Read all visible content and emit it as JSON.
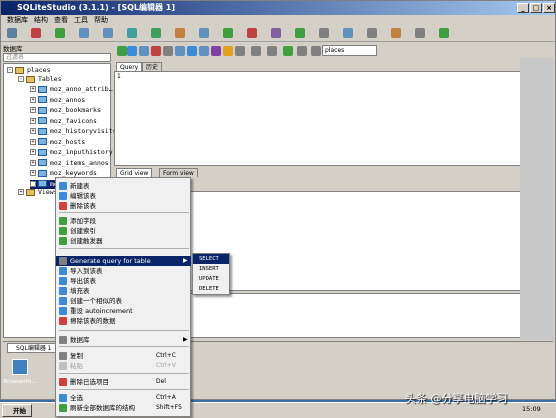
{
  "title": "SQLiteStudio (3.1.1) - [SQL编辑器 1]",
  "menu": [
    "数据库",
    "结构",
    "查看",
    "工具",
    "帮助"
  ],
  "sidebar": {
    "title": "数据库",
    "filter_placeholder": "过滤名",
    "db": "places",
    "db_version": "(SQLite 3)",
    "tables_label": "Tables",
    "tables_count": "(10)",
    "tables": [
      "moz_anno_attrib…",
      "moz_annos",
      "moz_bookmarks",
      "moz_favicons",
      "moz_historyvisits",
      "moz_hosts",
      "moz_inputhistory",
      "moz_items_annos",
      "moz_keywords",
      "moz_places"
    ],
    "views": "Views"
  },
  "editor": {
    "db_select": "places",
    "tabs": [
      "Query",
      "历史"
    ],
    "result_tabs": [
      "Grid view",
      "Form view"
    ]
  },
  "bottom_tab": "SQL编辑器 1",
  "context_menu": [
    {
      "label": "新建表",
      "shortcut": "",
      "icon": "new-table-icon",
      "color": "#3c8ad8"
    },
    {
      "label": "编辑该表",
      "shortcut": "",
      "icon": "edit-table-icon",
      "color": "#3c8ad8"
    },
    {
      "label": "删除该表",
      "shortcut": "",
      "icon": "delete-table-icon",
      "color": "#d04040"
    },
    {
      "label": "添加字段",
      "shortcut": "",
      "icon": "add-column-icon",
      "color": "#40a040"
    },
    {
      "label": "创建索引",
      "shortcut": "",
      "icon": "index-icon",
      "color": "#40a040"
    },
    {
      "label": "创建触发器",
      "shortcut": "",
      "icon": "trigger-icon",
      "color": "#40a040"
    },
    {
      "label": "Generate query for table",
      "shortcut": "",
      "icon": "generate-icon",
      "color": "#808080"
    },
    {
      "label": "导入到该表",
      "shortcut": "",
      "icon": "import-icon",
      "color": "#3c8ad8"
    },
    {
      "label": "导出该表",
      "shortcut": "",
      "icon": "export-icon",
      "color": "#3c8ad8"
    },
    {
      "label": "填充表",
      "shortcut": "",
      "icon": "populate-icon",
      "color": "#3c8ad8"
    },
    {
      "label": "创建一个相似的表",
      "shortcut": "",
      "icon": "similar-table-icon",
      "color": "#3c8ad8"
    },
    {
      "label": "重设 autoincrement",
      "shortcut": "",
      "icon": "reset-icon",
      "color": "#3c8ad8"
    },
    {
      "label": "擦除该表的数据",
      "shortcut": "",
      "icon": "erase-icon",
      "color": "#d04040"
    },
    {
      "label": "数据库",
      "shortcut": "",
      "icon": "database-icon",
      "color": "#808080"
    },
    {
      "label": "复制",
      "shortcut": "Ctrl+C",
      "icon": "copy-icon",
      "color": "#808080"
    },
    {
      "label": "粘贴",
      "shortcut": "Ctrl+V",
      "icon": "paste-icon",
      "color": "#c0c0c0"
    },
    {
      "label": "删除已选项目",
      "shortcut": "Del",
      "icon": "delete-icon",
      "color": "#d04040"
    },
    {
      "label": "全选",
      "shortcut": "Ctrl+A",
      "icon": "select-all-icon",
      "color": "#3c8ad8"
    },
    {
      "label": "刷新全部数据库的结构",
      "shortcut": "Shift+F5",
      "icon": "refresh-icon",
      "color": "#40a040"
    }
  ],
  "submenu": [
    "SELECT",
    "INSERT",
    "UPDATE",
    "DELETE"
  ],
  "desktop_icon": "BrowserHi...",
  "taskbar": {
    "start": "开始",
    "clock": "15:09"
  },
  "watermark": "头条 @分享电脑学习"
}
